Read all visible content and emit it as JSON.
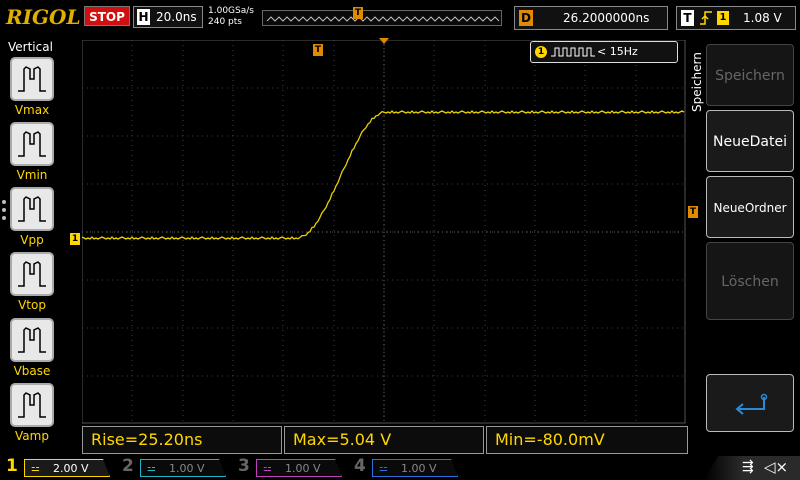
{
  "header": {
    "brand": "RIGOL",
    "run_state": "STOP",
    "timebase_key": "H",
    "timebase_value": "20.0ns",
    "sample_rate": "1.00GSa/s",
    "memory_depth": "240 pts",
    "delay_key": "D",
    "delay_value": "26.2000000ns",
    "trigger_key": "T",
    "trigger_source": "1",
    "trigger_level": "1.08 V",
    "trigger_marker": "T"
  },
  "left_menu": {
    "title": "Vertical",
    "items": [
      {
        "label": "Vmax",
        "icon": "vmax-icon"
      },
      {
        "label": "Vmin",
        "icon": "vmin-icon"
      },
      {
        "label": "Vpp",
        "icon": "vpp-icon"
      },
      {
        "label": "Vtop",
        "icon": "vtop-icon"
      },
      {
        "label": "Vbase",
        "icon": "vbase-icon"
      },
      {
        "label": "Vamp",
        "icon": "vamp-icon"
      }
    ]
  },
  "waveform": {
    "channel_marker": "1",
    "trigger_level_marker": "T",
    "frequency_channel": "1",
    "frequency_readout": "< 15Hz",
    "color": "#e8d000"
  },
  "measurements": [
    {
      "label": "Rise=25.20ns"
    },
    {
      "label": "Max=5.04 V"
    },
    {
      "label": "Min=-80.0mV"
    }
  ],
  "right_menu": {
    "title": "Speichern",
    "buttons": [
      {
        "label": "Speichern",
        "enabled": false
      },
      {
        "label": "NeueDatei",
        "enabled": true
      },
      {
        "label": "NeueOrdner",
        "enabled": true
      },
      {
        "label": "Löschen",
        "enabled": false
      },
      {
        "label": "",
        "enabled": true,
        "icon": "return-icon"
      }
    ]
  },
  "channels": [
    {
      "num": "1",
      "scale": "2.00 V",
      "color": "#ffd700",
      "active": true
    },
    {
      "num": "2",
      "scale": "1.00 V",
      "color": "#1fb5c9",
      "active": false
    },
    {
      "num": "3",
      "scale": "1.00 V",
      "color": "#c040c0",
      "active": false
    },
    {
      "num": "4",
      "scale": "1.00 V",
      "color": "#2a70e0",
      "active": false
    }
  ],
  "status_icons": [
    "usb-icon",
    "mute-icon"
  ]
}
